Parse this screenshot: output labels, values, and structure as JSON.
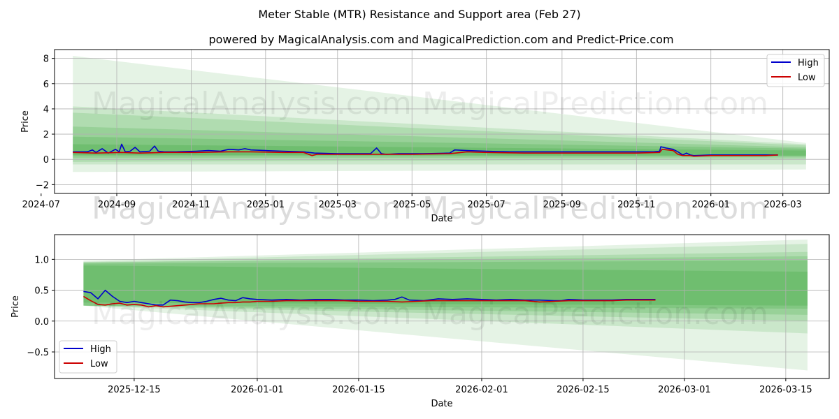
{
  "title": "Meter Stable (MTR) Resistance and Support area (Feb 27)",
  "subtitle": "powered by MagicalAnalysis.com and MagicalPrediction.com and Predict-Price.com",
  "watermarks": [
    "MagicalAnalysis.com",
    "MagicalPrediction.com"
  ],
  "colors": {
    "high": "#0000cc",
    "low": "#cc0000",
    "band": "#2ca02c"
  },
  "chart_data": [
    {
      "type": "line",
      "xlabel": "Date",
      "ylabel": "Price",
      "x_ticks": [
        "2024-07",
        "2024-09",
        "2024-11",
        "2025-01",
        "2025-03",
        "2025-05",
        "2025-07",
        "2025-09",
        "2025-11",
        "2026-01",
        "2026-03"
      ],
      "y_ticks": [
        "−2",
        "0",
        "2",
        "4",
        "6",
        "8"
      ],
      "xlim": [
        "2024-07-12",
        "2026-04-08"
      ],
      "ylim": [
        -2.7,
        8.7
      ],
      "grid": true,
      "legend": "top-right",
      "legend_entries": [
        "High",
        "Low"
      ],
      "band_range": [
        "2024-07-27",
        "2026-03-20"
      ],
      "bands": [
        {
          "upper": [
            8.2,
            1.3
          ],
          "lower": [
            -1.0,
            -0.8
          ]
        },
        {
          "upper": [
            4.2,
            1.2
          ],
          "lower": [
            -0.4,
            -0.4
          ]
        },
        {
          "upper": [
            3.7,
            1.1
          ],
          "lower": [
            -0.2,
            0.0
          ]
        },
        {
          "upper": [
            2.6,
            0.95
          ],
          "lower": [
            0.1,
            0.15
          ]
        },
        {
          "upper": [
            1.8,
            0.85
          ],
          "lower": [
            0.25,
            0.25
          ]
        },
        {
          "upper": [
            1.2,
            0.7
          ],
          "lower": [
            0.35,
            0.3
          ]
        }
      ],
      "series": [
        {
          "name": "High",
          "x": [
            "2024-07-27",
            "2024-08-08",
            "2024-08-12",
            "2024-08-15",
            "2024-08-20",
            "2024-08-25",
            "2024-08-31",
            "2024-09-03",
            "2024-09-05",
            "2024-09-08",
            "2024-09-12",
            "2024-09-16",
            "2024-09-20",
            "2024-09-28",
            "2024-10-02",
            "2024-10-05",
            "2024-10-10",
            "2024-10-20",
            "2024-11-05",
            "2024-11-15",
            "2024-11-25",
            "2024-12-02",
            "2024-12-10",
            "2024-12-15",
            "2024-12-20",
            "2025-01-01",
            "2025-01-15",
            "2025-02-01",
            "2025-02-10",
            "2025-03-01",
            "2025-03-15",
            "2025-03-28",
            "2025-04-02",
            "2025-04-06",
            "2025-04-10",
            "2025-04-20",
            "2025-05-10",
            "2025-06-01",
            "2025-06-05",
            "2025-06-15",
            "2025-07-01",
            "2025-07-20",
            "2025-08-10",
            "2025-09-01",
            "2025-09-20",
            "2025-10-05",
            "2025-10-25",
            "2025-11-05",
            "2025-11-15",
            "2025-11-20",
            "2025-11-21",
            "2025-11-25",
            "2025-12-01",
            "2025-12-05",
            "2025-12-09",
            "2025-12-12",
            "2025-12-15",
            "2025-12-18",
            "2026-01-01",
            "2026-01-15",
            "2026-02-01",
            "2026-02-15",
            "2026-02-25"
          ],
          "y": [
            0.6,
            0.6,
            0.75,
            0.55,
            0.85,
            0.5,
            0.8,
            0.6,
            1.2,
            0.6,
            0.65,
            0.95,
            0.6,
            0.65,
            1.05,
            0.65,
            0.6,
            0.6,
            0.65,
            0.7,
            0.65,
            0.8,
            0.75,
            0.85,
            0.75,
            0.7,
            0.65,
            0.6,
            0.5,
            0.45,
            0.45,
            0.45,
            0.9,
            0.45,
            0.4,
            0.45,
            0.45,
            0.5,
            0.75,
            0.7,
            0.65,
            0.6,
            0.6,
            0.6,
            0.6,
            0.6,
            0.6,
            0.6,
            0.6,
            0.65,
            1.0,
            0.9,
            0.8,
            0.6,
            0.35,
            0.5,
            0.35,
            0.3,
            0.35,
            0.35,
            0.35,
            0.35,
            0.35
          ]
        },
        {
          "name": "Low",
          "x": [
            "2024-07-27",
            "2024-08-15",
            "2024-09-05",
            "2024-09-20",
            "2024-10-10",
            "2024-11-05",
            "2024-12-01",
            "2024-12-20",
            "2025-01-15",
            "2025-02-01",
            "2025-02-08",
            "2025-02-12",
            "2025-03-01",
            "2025-04-01",
            "2025-05-01",
            "2025-06-01",
            "2025-06-15",
            "2025-07-01",
            "2025-08-01",
            "2025-09-01",
            "2025-10-01",
            "2025-11-01",
            "2025-11-20",
            "2025-11-22",
            "2025-12-01",
            "2025-12-05",
            "2025-12-09",
            "2025-12-15",
            "2025-12-18",
            "2026-01-01",
            "2026-01-15",
            "2026-02-01",
            "2026-02-15",
            "2026-02-25"
          ],
          "y": [
            0.55,
            0.5,
            0.55,
            0.5,
            0.55,
            0.55,
            0.6,
            0.6,
            0.55,
            0.55,
            0.3,
            0.4,
            0.4,
            0.4,
            0.4,
            0.45,
            0.6,
            0.55,
            0.5,
            0.5,
            0.5,
            0.5,
            0.55,
            0.8,
            0.7,
            0.4,
            0.3,
            0.3,
            0.25,
            0.3,
            0.3,
            0.3,
            0.3,
            0.35
          ]
        }
      ]
    },
    {
      "type": "line",
      "xlabel": "Date",
      "ylabel": "Price",
      "x_ticks": [
        "2025-12-15",
        "2026-01-01",
        "2026-01-15",
        "2026-02-01",
        "2026-02-15",
        "2026-03-01",
        "2026-03-15"
      ],
      "y_ticks": [
        "−0.5",
        "0.0",
        "0.5",
        "1.0"
      ],
      "xlim": [
        "2025-12-04",
        "2026-03-21"
      ],
      "ylim": [
        -0.93,
        1.4
      ],
      "grid": true,
      "legend": "bottom-left",
      "legend_entries": [
        "High",
        "Low"
      ],
      "band_range": [
        "2025-12-08",
        "2026-03-18"
      ],
      "bands": [
        {
          "upper": [
            0.98,
            1.32
          ],
          "lower": [
            0.25,
            -0.8
          ]
        },
        {
          "upper": [
            0.96,
            1.25
          ],
          "lower": [
            0.25,
            -0.2
          ]
        },
        {
          "upper": [
            0.95,
            1.12
          ],
          "lower": [
            0.25,
            0.0
          ]
        },
        {
          "upper": [
            0.95,
            1.05
          ],
          "lower": [
            0.25,
            0.1
          ]
        },
        {
          "upper": [
            0.93,
            0.98
          ],
          "lower": [
            0.25,
            0.2
          ]
        },
        {
          "upper": [
            0.9,
            0.8
          ],
          "lower": [
            0.3,
            0.25
          ]
        }
      ],
      "series": [
        {
          "name": "High",
          "x": [
            "2025-12-08",
            "2025-12-09",
            "2025-12-10",
            "2025-12-11",
            "2025-12-12",
            "2025-12-13",
            "2025-12-14",
            "2025-12-15",
            "2025-12-16",
            "2025-12-17",
            "2025-12-18",
            "2025-12-19",
            "2025-12-20",
            "2025-12-21",
            "2025-12-22",
            "2025-12-23",
            "2025-12-24",
            "2025-12-25",
            "2025-12-26",
            "2025-12-27",
            "2025-12-28",
            "2025-12-29",
            "2025-12-30",
            "2025-12-31",
            "2026-01-01",
            "2026-01-03",
            "2026-01-05",
            "2026-01-07",
            "2026-01-09",
            "2026-01-11",
            "2026-01-13",
            "2026-01-15",
            "2026-01-17",
            "2026-01-19",
            "2026-01-20",
            "2026-01-21",
            "2026-01-22",
            "2026-01-24",
            "2026-01-26",
            "2026-01-28",
            "2026-01-30",
            "2026-02-01",
            "2026-02-03",
            "2026-02-05",
            "2026-02-07",
            "2026-02-09",
            "2026-02-11",
            "2026-02-12",
            "2026-02-13",
            "2026-02-15",
            "2026-02-17",
            "2026-02-19",
            "2026-02-21",
            "2026-02-23",
            "2026-02-25"
          ],
          "y": [
            0.48,
            0.46,
            0.36,
            0.5,
            0.4,
            0.32,
            0.3,
            0.32,
            0.3,
            0.28,
            0.26,
            0.26,
            0.34,
            0.33,
            0.31,
            0.3,
            0.3,
            0.32,
            0.35,
            0.37,
            0.34,
            0.33,
            0.38,
            0.36,
            0.35,
            0.34,
            0.35,
            0.34,
            0.35,
            0.35,
            0.34,
            0.34,
            0.33,
            0.34,
            0.35,
            0.39,
            0.34,
            0.33,
            0.36,
            0.35,
            0.36,
            0.35,
            0.34,
            0.35,
            0.34,
            0.34,
            0.33,
            0.33,
            0.35,
            0.34,
            0.34,
            0.34,
            0.35,
            0.35,
            0.35
          ]
        },
        {
          "name": "Low",
          "x": [
            "2025-12-08",
            "2025-12-09",
            "2025-12-10",
            "2025-12-11",
            "2025-12-12",
            "2025-12-13",
            "2025-12-14",
            "2025-12-15",
            "2025-12-16",
            "2025-12-17",
            "2025-12-18",
            "2025-12-19",
            "2025-12-20",
            "2025-12-21",
            "2025-12-22",
            "2025-12-23",
            "2025-12-24",
            "2025-12-25",
            "2025-12-26",
            "2025-12-27",
            "2025-12-28",
            "2025-12-29",
            "2025-12-30",
            "2025-12-31",
            "2026-01-01",
            "2026-01-03",
            "2026-01-05",
            "2026-01-07",
            "2026-01-09",
            "2026-01-11",
            "2026-01-13",
            "2026-01-15",
            "2026-01-17",
            "2026-01-19",
            "2026-01-21",
            "2026-01-23",
            "2026-01-25",
            "2026-01-27",
            "2026-01-29",
            "2026-02-01",
            "2026-02-03",
            "2026-02-05",
            "2026-02-07",
            "2026-02-09",
            "2026-02-11",
            "2026-02-13",
            "2026-02-15",
            "2026-02-17",
            "2026-02-19",
            "2026-02-21",
            "2026-02-23",
            "2026-02-25"
          ],
          "y": [
            0.4,
            0.33,
            0.27,
            0.26,
            0.28,
            0.29,
            0.26,
            0.27,
            0.26,
            0.23,
            0.25,
            0.23,
            0.24,
            0.25,
            0.26,
            0.27,
            0.28,
            0.28,
            0.28,
            0.29,
            0.3,
            0.3,
            0.31,
            0.31,
            0.32,
            0.32,
            0.33,
            0.33,
            0.33,
            0.33,
            0.33,
            0.32,
            0.32,
            0.32,
            0.31,
            0.32,
            0.33,
            0.33,
            0.33,
            0.33,
            0.33,
            0.33,
            0.33,
            0.31,
            0.32,
            0.33,
            0.33,
            0.33,
            0.33,
            0.34,
            0.34,
            0.34
          ]
        }
      ]
    }
  ]
}
